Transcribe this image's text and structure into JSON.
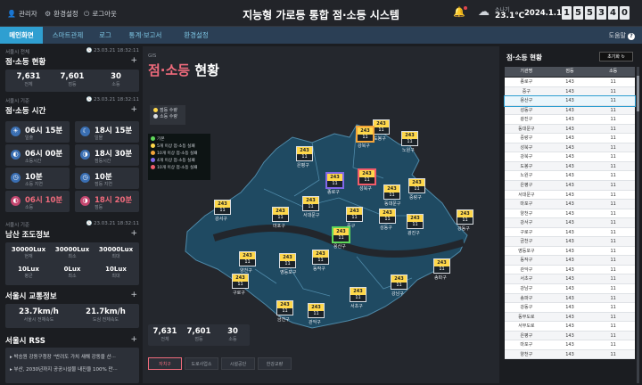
{
  "top": {
    "links": [
      {
        "icon": "person-icon",
        "label": "관리자"
      },
      {
        "icon": "gear-icon",
        "label": "환경설정"
      },
      {
        "icon": "power-icon",
        "label": "로그아웃"
      }
    ],
    "title": "지능형 가로등 통합 점·소등 시스템",
    "weather_label": "소나기",
    "temp": "23.1℃",
    "date": "2024.1.15",
    "clock": [
      "1",
      "5",
      "5",
      "3",
      "4",
      "0"
    ]
  },
  "nav": {
    "tabs": [
      "메인화면",
      "스마트관제",
      "로그",
      "통계·보고서",
      "환경설정"
    ],
    "help": "도움말"
  },
  "left": {
    "count_section": {
      "caption": "서울시 전체",
      "ts": "23.03.21 18:32:11",
      "title": "점·소등 현황",
      "values": [
        {
          "v": "7,631",
          "l": "전체"
        },
        {
          "v": "7,601",
          "l": "점등"
        },
        {
          "v": "30",
          "l": "소등"
        }
      ]
    },
    "time_section": {
      "caption": "서울시 기준",
      "ts": "23.03.21 18:32:11",
      "title": "점·소등 시간",
      "items": [
        {
          "v": "06시 15분",
          "l": "일출"
        },
        {
          "v": "18시 15분",
          "l": "일몰"
        },
        {
          "v": "06시 00분",
          "l": "소등시간"
        },
        {
          "v": "18시 30분",
          "l": "점등시간"
        },
        {
          "v": "10분",
          "l": "소등 지연"
        },
        {
          "v": "10분",
          "l": "점등 지연"
        },
        {
          "v": "06시 10분",
          "l": "소등"
        },
        {
          "v": "18시 20분",
          "l": "점등"
        }
      ]
    },
    "lux_section": {
      "caption": "서울시 기준",
      "ts": "23.03.21 18:32:11",
      "title": "남산 조도정보",
      "items": [
        {
          "v": "30000Lux",
          "l": "현재"
        },
        {
          "v": "30000Lux",
          "l": "최소"
        },
        {
          "v": "30000Lux",
          "l": "최대"
        },
        {
          "v": "10Lux",
          "l": "평균"
        },
        {
          "v": "0Lux",
          "l": "최소"
        },
        {
          "v": "10Lux",
          "l": "최대"
        }
      ]
    },
    "traffic_section": {
      "title": "서울시 교통정보",
      "items": [
        {
          "v": "23.7km/h",
          "l": "서울시 전체속도"
        },
        {
          "v": "21.7km/h",
          "l": "도심 전체속도"
        }
      ]
    },
    "rss_section": {
      "title": "서울시 RSS",
      "items": [
        "▸ 박승원 강동구청장 \"반려도 가치 새해 강동을 산···",
        "▸ 부산, 2030년까지 공공시설물 내진율 100% 만···"
      ]
    }
  },
  "center": {
    "gis": "GIS",
    "title_hl": "점·소등",
    "title_rest": " 현황",
    "legend1": [
      "점등 수량",
      "소등 수량"
    ],
    "legend2": [
      "기본",
      "5개 이상 점·소등 실패",
      "10개 이상 점·소등 실패",
      "4개 이상 점·소등 실패",
      "10개 이상 점·소등 실패"
    ],
    "colors": {
      "yellow": "#ffd84b",
      "orange": "#f3a53b",
      "red": "#f25c6a",
      "purple": "#8168e8",
      "green": "#60d85a",
      "land": "#1f4a62"
    },
    "stats": [
      {
        "v": "7,631",
        "l": "전체"
      },
      {
        "v": "7,601",
        "l": "점등"
      },
      {
        "v": "30",
        "l": "소등"
      }
    ],
    "tabs": [
      "자치구",
      "도로사업소",
      "시설공단",
      "한강교량"
    ],
    "markers": [
      {
        "name": "도봉구",
        "on": "243",
        "off": "11",
        "c": ""
      },
      {
        "name": "강북구",
        "on": "243",
        "off": "11",
        "c": "o"
      },
      {
        "name": "노원구",
        "on": "243",
        "off": "11",
        "c": ""
      },
      {
        "name": "은평구",
        "on": "243",
        "off": "11",
        "c": ""
      },
      {
        "name": "성북구",
        "on": "243",
        "off": "11",
        "c": "r"
      },
      {
        "name": "중랑구",
        "on": "243",
        "off": "11",
        "c": ""
      },
      {
        "name": "종로구",
        "on": "243",
        "off": "11",
        "c": "p"
      },
      {
        "name": "동대문구",
        "on": "243",
        "off": "11",
        "c": ""
      },
      {
        "name": "서대문구",
        "on": "243",
        "off": "11",
        "c": ""
      },
      {
        "name": "중구",
        "on": "243",
        "off": "11",
        "c": ""
      },
      {
        "name": "성동구",
        "on": "243",
        "off": "11",
        "c": ""
      },
      {
        "name": "광진구",
        "on": "243",
        "off": "11",
        "c": ""
      },
      {
        "name": "강서구",
        "on": "243",
        "off": "11",
        "c": ""
      },
      {
        "name": "마포구",
        "on": "243",
        "off": "11",
        "c": ""
      },
      {
        "name": "용산구",
        "on": "243",
        "off": "11",
        "c": "g"
      },
      {
        "name": "강동구",
        "on": "243",
        "off": "11",
        "c": ""
      },
      {
        "name": "양천구",
        "on": "243",
        "off": "11",
        "c": ""
      },
      {
        "name": "영등포구",
        "on": "243",
        "off": "11",
        "c": ""
      },
      {
        "name": "동작구",
        "on": "243",
        "off": "11",
        "c": ""
      },
      {
        "name": "송파구",
        "on": "243",
        "off": "11",
        "c": ""
      },
      {
        "name": "구로구",
        "on": "243",
        "off": "11",
        "c": ""
      },
      {
        "name": "강남구",
        "on": "243",
        "off": "11",
        "c": ""
      },
      {
        "name": "서초구",
        "on": "243",
        "off": "11",
        "c": ""
      },
      {
        "name": "금천구",
        "on": "243",
        "off": "11",
        "c": ""
      },
      {
        "name": "관악구",
        "on": "243",
        "off": "11",
        "c": ""
      }
    ]
  },
  "right": {
    "title": "점·소등 현황",
    "reset": "초기화",
    "headers": [
      "기관명",
      "점등",
      "소등"
    ],
    "rows": [
      [
        "종로구",
        "143",
        "11"
      ],
      [
        "중구",
        "143",
        "11"
      ],
      [
        "용산구",
        "143",
        "11"
      ],
      [
        "성동구",
        "143",
        "11"
      ],
      [
        "광진구",
        "143",
        "11"
      ],
      [
        "동대문구",
        "143",
        "11"
      ],
      [
        "중랑구",
        "143",
        "11"
      ],
      [
        "성북구",
        "143",
        "11"
      ],
      [
        "강북구",
        "143",
        "11"
      ],
      [
        "도봉구",
        "143",
        "11"
      ],
      [
        "노원구",
        "143",
        "11"
      ],
      [
        "은평구",
        "143",
        "11"
      ],
      [
        "서대문구",
        "143",
        "11"
      ],
      [
        "마포구",
        "143",
        "11"
      ],
      [
        "양천구",
        "143",
        "11"
      ],
      [
        "강서구",
        "143",
        "11"
      ],
      [
        "구로구",
        "143",
        "11"
      ],
      [
        "금천구",
        "143",
        "11"
      ],
      [
        "영등포구",
        "143",
        "11"
      ],
      [
        "동작구",
        "143",
        "11"
      ],
      [
        "관악구",
        "143",
        "11"
      ],
      [
        "서초구",
        "143",
        "11"
      ],
      [
        "강남구",
        "143",
        "11"
      ],
      [
        "송파구",
        "143",
        "11"
      ],
      [
        "강동구",
        "143",
        "11"
      ],
      [
        "동부도로",
        "143",
        "11"
      ],
      [
        "서부도로",
        "143",
        "11"
      ],
      [
        "은평구",
        "143",
        "11"
      ],
      [
        "마포구",
        "143",
        "11"
      ],
      [
        "양천구",
        "143",
        "11"
      ]
    ],
    "selected": 2
  }
}
